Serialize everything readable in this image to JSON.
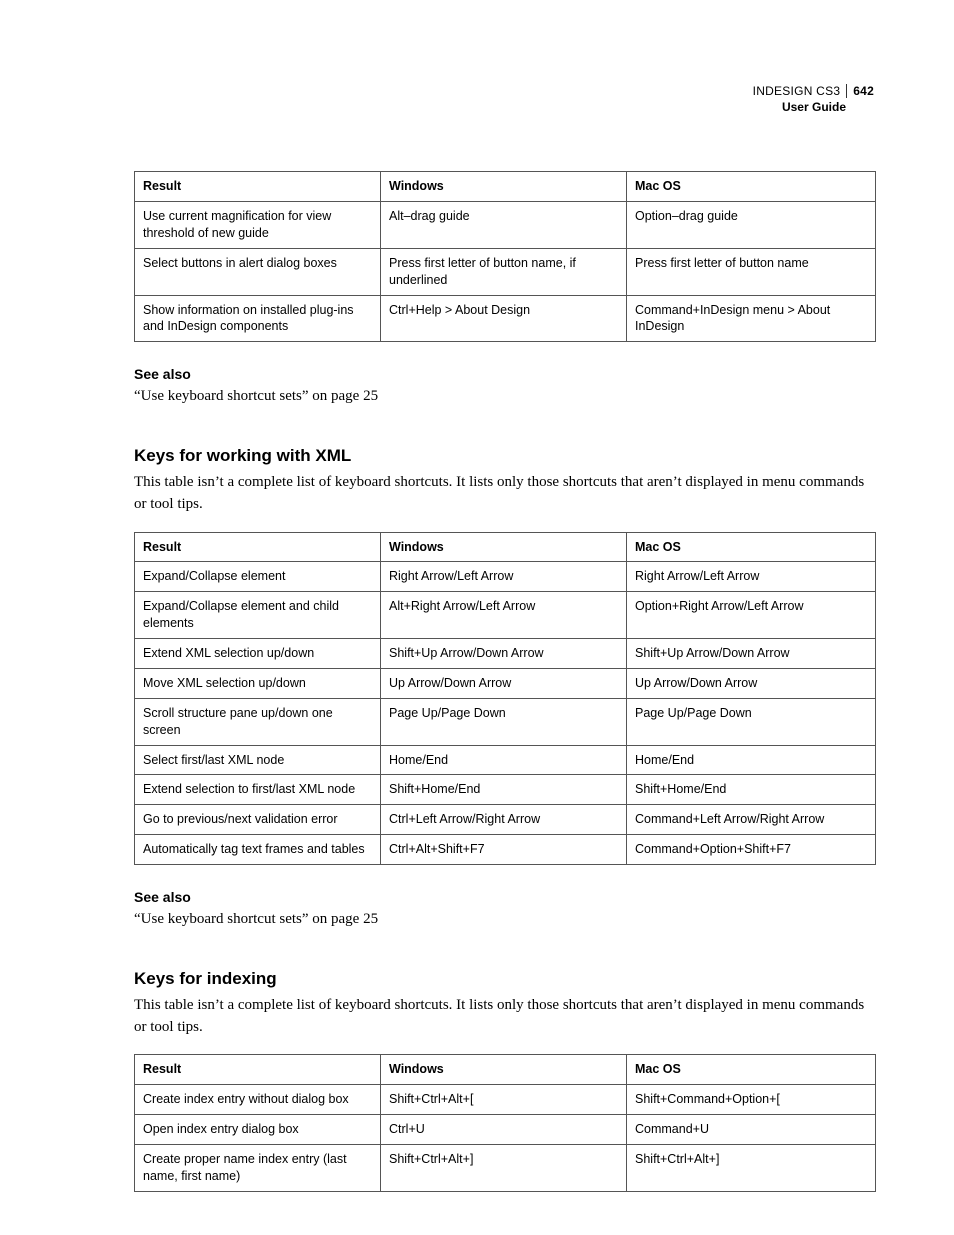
{
  "header": {
    "product": "INDESIGN CS3",
    "page_number": "642",
    "subtitle": "User Guide"
  },
  "table1": {
    "headers": {
      "c1": "Result",
      "c2": "Windows",
      "c3": "Mac OS"
    },
    "rows": [
      {
        "c1": "Use current magnification for view threshold of new guide",
        "c2": "Alt–drag guide",
        "c3": "Option–drag guide"
      },
      {
        "c1": "Select buttons in alert dialog boxes",
        "c2": "Press first letter of button name, if underlined",
        "c3": "Press first letter of button name"
      },
      {
        "c1": "Show information on installed plug-ins and InDesign components",
        "c2": "Ctrl+Help > About Design",
        "c3": "Command+InDesign menu > About InDesign"
      }
    ]
  },
  "see_also1": {
    "heading": "See also",
    "ref": "“Use keyboard shortcut sets” on page 25"
  },
  "section_xml": {
    "heading": "Keys for working with XML",
    "intro": "This table isn’t a complete list of keyboard shortcuts. It lists only those shortcuts that aren’t displayed in menu commands or tool tips."
  },
  "table2": {
    "headers": {
      "c1": "Result",
      "c2": "Windows",
      "c3": "Mac OS"
    },
    "rows": [
      {
        "c1": "Expand/Collapse element",
        "c2": "Right Arrow/Left Arrow",
        "c3": "Right Arrow/Left Arrow"
      },
      {
        "c1": "Expand/Collapse element and child elements",
        "c2": "Alt+Right Arrow/Left Arrow",
        "c3": "Option+Right Arrow/Left Arrow"
      },
      {
        "c1": "Extend XML selection up/down",
        "c2": "Shift+Up Arrow/Down Arrow",
        "c3": "Shift+Up Arrow/Down Arrow"
      },
      {
        "c1": "Move XML selection up/down",
        "c2": "Up Arrow/Down Arrow",
        "c3": "Up Arrow/Down Arrow"
      },
      {
        "c1": "Scroll structure pane up/down one screen",
        "c2": "Page Up/Page Down",
        "c3": "Page Up/Page Down"
      },
      {
        "c1": "Select first/last XML node",
        "c2": "Home/End",
        "c3": "Home/End"
      },
      {
        "c1": "Extend selection to first/last XML node",
        "c2": "Shift+Home/End",
        "c3": "Shift+Home/End"
      },
      {
        "c1": "Go to previous/next validation error",
        "c2": "Ctrl+Left Arrow/Right Arrow",
        "c3": "Command+Left Arrow/Right Arrow"
      },
      {
        "c1": "Automatically tag text frames and tables",
        "c2": "Ctrl+Alt+Shift+F7",
        "c3": "Command+Option+Shift+F7"
      }
    ]
  },
  "see_also2": {
    "heading": "See also",
    "ref": "“Use keyboard shortcut sets” on page 25"
  },
  "section_index": {
    "heading": "Keys for indexing",
    "intro": "This table isn’t a complete list of keyboard shortcuts. It lists only those shortcuts that aren’t displayed in menu commands or tool tips."
  },
  "table3": {
    "headers": {
      "c1": "Result",
      "c2": "Windows",
      "c3": "Mac OS"
    },
    "rows": [
      {
        "c1": "Create index entry without dialog box",
        "c2": "Shift+Ctrl+Alt+[",
        "c3": "Shift+Command+Option+["
      },
      {
        "c1": "Open index entry dialog box",
        "c2": "Ctrl+U",
        "c3": "Command+U"
      },
      {
        "c1": "Create proper name index entry (last name, first name)",
        "c2": "Shift+Ctrl+Alt+]",
        "c3": "Shift+Ctrl+Alt+]"
      }
    ]
  }
}
